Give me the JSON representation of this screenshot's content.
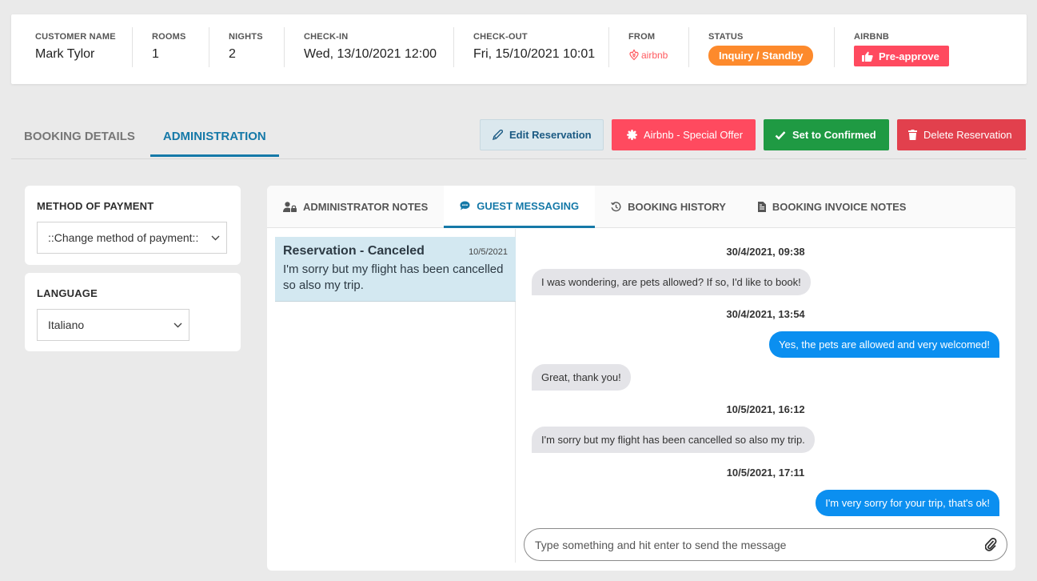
{
  "summary": {
    "customer_name": {
      "label": "CUSTOMER NAME",
      "value": "Mark Tylor"
    },
    "rooms": {
      "label": "ROOMS",
      "value": "1"
    },
    "nights": {
      "label": "NIGHTS",
      "value": "2"
    },
    "check_in": {
      "label": "CHECK-IN",
      "value": "Wed, 13/10/2021 12:00"
    },
    "check_out": {
      "label": "CHECK-OUT",
      "value": "Fri, 15/10/2021 10:01"
    },
    "from": {
      "label": "FROM",
      "value": "airbnb",
      "icon": "airbnb-logo-icon"
    },
    "status": {
      "label": "STATUS",
      "value": "Inquiry / Standby",
      "color": "#fd8a2c"
    },
    "airbnb": {
      "label": "AIRBNB",
      "button": "Pre-approve",
      "icon": "thumbs-up-icon",
      "color": "#ff4a5f"
    }
  },
  "main_tabs": [
    {
      "label": "BOOKING DETAILS",
      "active": false
    },
    {
      "label": "ADMINISTRATION",
      "active": true
    }
  ],
  "actions": {
    "edit": {
      "label": "Edit Reservation",
      "icon": "pencil-icon"
    },
    "offer": {
      "label": "Airbnb - Special Offer",
      "icon": "badge-icon"
    },
    "confirm": {
      "label": "Set to Confirmed",
      "icon": "check-icon"
    },
    "delete": {
      "label": "Delete Reservation",
      "icon": "trash-icon"
    }
  },
  "payment": {
    "label": "METHOD OF PAYMENT",
    "selected": "::Change method of payment::"
  },
  "language": {
    "label": "LANGUAGE",
    "selected": "Italiano"
  },
  "sub_tabs": [
    {
      "label": "ADMINISTRATOR NOTES",
      "icon": "user-lock-icon",
      "active": false
    },
    {
      "label": "GUEST MESSAGING",
      "icon": "chat-icon",
      "active": true
    },
    {
      "label": "BOOKING HISTORY",
      "icon": "history-icon",
      "active": false
    },
    {
      "label": "BOOKING INVOICE NOTES",
      "icon": "document-icon",
      "active": false
    }
  ],
  "conversation": {
    "title": "Reservation - Canceled",
    "date": "10/5/2021",
    "preview": "I'm sorry but my flight has been cancelled so also my trip."
  },
  "thread": [
    {
      "type": "timestamp",
      "text": "30/4/2021, 09:38"
    },
    {
      "type": "incoming",
      "text": "I was wondering, are pets allowed? If so, I'd like to book!"
    },
    {
      "type": "timestamp",
      "text": "30/4/2021, 13:54"
    },
    {
      "type": "outgoing",
      "text": "Yes, the pets are allowed and very welcomed!"
    },
    {
      "type": "incoming",
      "text": "Great, thank you!"
    },
    {
      "type": "timestamp",
      "text": "10/5/2021, 16:12"
    },
    {
      "type": "incoming",
      "text": "I'm sorry but my flight has been cancelled so also my trip."
    },
    {
      "type": "timestamp",
      "text": "10/5/2021, 17:11"
    },
    {
      "type": "outgoing",
      "text": "I'm very sorry for your trip, that's ok!"
    }
  ],
  "composer": {
    "placeholder": "Type something and hit enter to send the message",
    "icon": "paperclip-icon"
  }
}
